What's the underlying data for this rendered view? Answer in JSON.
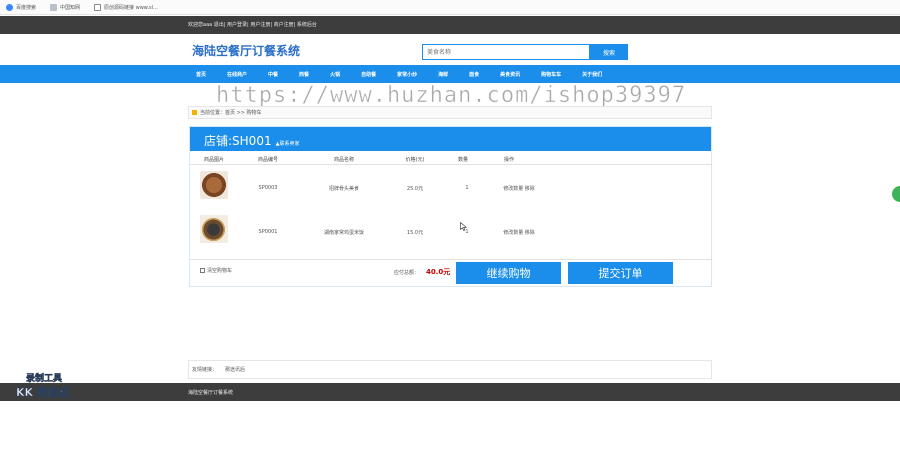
{
  "browser": {
    "bookmarks": [
      {
        "label": "百度搜索",
        "icon": "paw-icon"
      },
      {
        "label": "中国知网",
        "icon": "globe-icon"
      },
      {
        "label": "原创源码链接 www.sl...",
        "icon": "page-icon"
      }
    ]
  },
  "topbar": {
    "text": "欢迎您aaa 退出| 用户登录| 用户注册| 商户注册| 系统后台"
  },
  "header": {
    "site_title": "海陆空餐厅订餐系统",
    "search": {
      "placeholder": "美食名称",
      "button_label": "搜索"
    }
  },
  "nav": {
    "items": [
      "首页",
      "在线商户",
      "中餐",
      "西餐",
      "火锅",
      "自助餐",
      "家常小炒",
      "海鲜",
      "面食",
      "美食资讯",
      "购物车车",
      "关于我们"
    ]
  },
  "watermark": "https://www.huzhan.com/ishop39397",
  "breadcrumb": "当前位置：首页 >> 购物车",
  "cart": {
    "shop_label": "店铺:SH001",
    "contact_label": "▲联系卖家",
    "columns": [
      "商品图片",
      "商品编号",
      "商品名称",
      "价格(元)",
      "数量",
      "操作"
    ],
    "rows": [
      {
        "code": "SP0003",
        "name": "招牌骨头美食",
        "price": "25.0元",
        "qty": "1",
        "actions": "修改数量 移除"
      },
      {
        "code": "SP0001",
        "name": "湖南家常鸡蛋米饭",
        "price": "15.0元",
        "qty": "1",
        "actions": "修改数量 移除"
      }
    ],
    "clear_label": "清空购物车",
    "total_label": "应付总额：",
    "total_value": "40.0元",
    "continue_label": "继续购物",
    "submit_label": "提交订单"
  },
  "friend_links": {
    "label": "友情链接：",
    "value": "那途讯后"
  },
  "footer": {
    "text": "海陆空餐厅订餐系统"
  },
  "recorder": {
    "top": "录制工具",
    "bottom": "KK 录像机"
  },
  "colors": {
    "accent": "#1a8eea",
    "dark_bar": "#3d3d3d",
    "total_red": "#c40000"
  }
}
